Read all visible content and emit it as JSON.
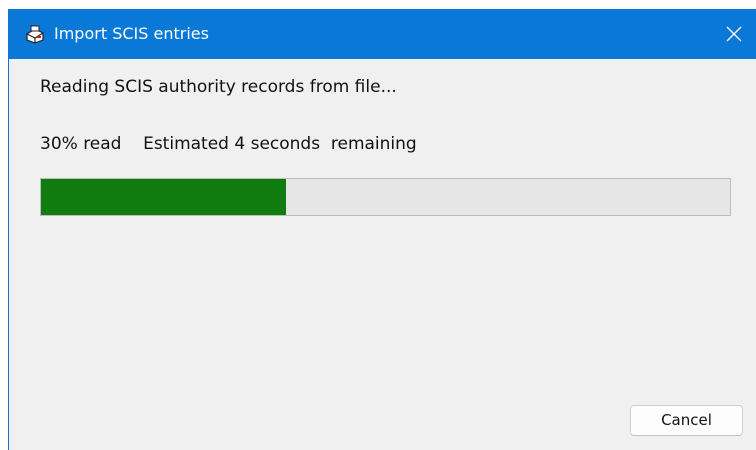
{
  "window": {
    "title": "Import SCIS entries",
    "icon": "printer-book-icon",
    "close_icon": "close-icon"
  },
  "status": {
    "message": "Reading SCIS authority records from file...",
    "progress_text": "30% read    Estimated 4 seconds  remaining"
  },
  "progress": {
    "fraction": 0.355,
    "fill_color": "#107c10",
    "track_color": "#e6e6e6"
  },
  "buttons": {
    "cancel_label": "Cancel"
  },
  "colors": {
    "titlebar": "#0a78d7",
    "window_bg": "#f0f0f0"
  }
}
